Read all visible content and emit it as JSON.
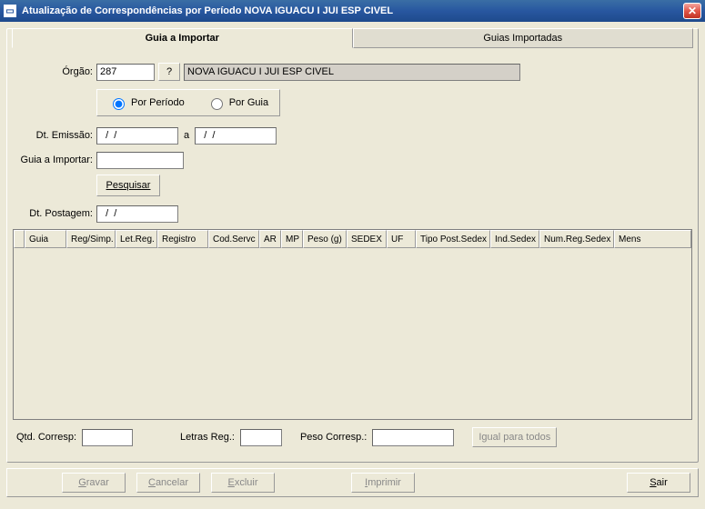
{
  "titlebar": {
    "text": "Atualização de Correspondências por Período    NOVA IGUACU I JUI ESP CIVEL"
  },
  "tabs": {
    "import": "Guia a Importar",
    "imported": "Guias Importadas"
  },
  "form": {
    "orgao_label": "Órgão:",
    "orgao_value": "287",
    "orgao_help": "?",
    "orgao_desc": "NOVA IGUACU I JUI ESP CIVEL",
    "radio_periodo": "Por Período",
    "radio_guia": "Por Guia",
    "dt_emissao_label": "Dt. Emissão:",
    "dt_emissao_from": "  /  /",
    "dt_emissao_sep": "a",
    "dt_emissao_to": "  /  /",
    "guia_importar_label": "Guia a Importar:",
    "guia_importar_value": "",
    "pesquisar": "Pesquisar",
    "dt_postagem_label": "Dt. Postagem:",
    "dt_postagem_value": "  /  /"
  },
  "grid": {
    "columns": [
      "Guia",
      "Reg/Simp.",
      "Let.Reg.",
      "Registro",
      "Cod.Servc",
      "AR",
      "MP",
      "Peso (g)",
      "SEDEX",
      "UF",
      "Tipo Post.Sedex",
      "Ind.Sedex",
      "Num.Reg.Sedex",
      "Mens"
    ]
  },
  "summary": {
    "qtd_label": "Qtd. Corresp:",
    "qtd_value": "",
    "letras_label": "Letras Reg.:",
    "letras_value": "",
    "peso_label": "Peso Corresp.:",
    "peso_value": "",
    "igual_label": "Igual para todos"
  },
  "actions": {
    "gravar": "Gravar",
    "cancelar": "Cancelar",
    "excluir": "Excluir",
    "imprimir": "Imprimir",
    "sair": "Sair"
  }
}
